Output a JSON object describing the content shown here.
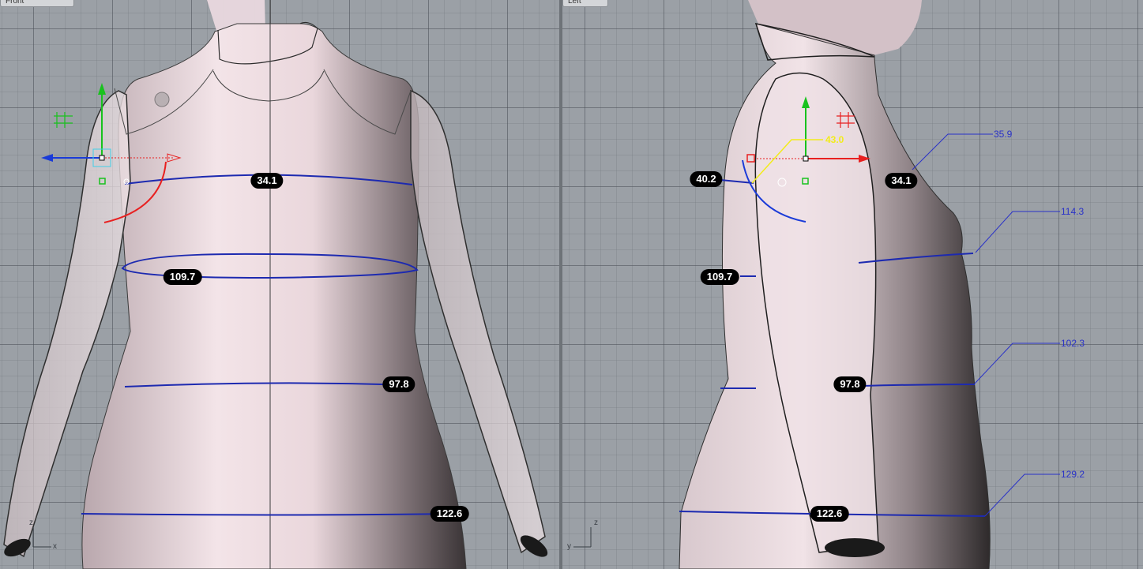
{
  "viewports": {
    "front": {
      "title": "Front"
    },
    "left": {
      "title": "Left"
    }
  },
  "front_measurements": {
    "shoulder": "34.1",
    "bust": "109.7",
    "waist": "97.8",
    "hip": "122.6"
  },
  "left_measurements": {
    "arm": "40.2",
    "shoulder": "34.1",
    "bust": "109.7",
    "waist": "97.8",
    "hip": "122.6"
  },
  "left_annotations": {
    "neck": "35.9",
    "bust": "114.3",
    "waist": "102.3",
    "hip": "129.2",
    "gumball_value": "43.0"
  },
  "axes": {
    "front": {
      "z": "z",
      "x": "x"
    },
    "left": {
      "z": "z",
      "y": "y"
    }
  },
  "colors": {
    "measure_line": "#1d2ab0",
    "label_bg": "#000000",
    "gumball_x": "#e82020",
    "gumball_y": "#18c21e",
    "gumball_z": "#1a3bd8",
    "annotation": "#2a32c8",
    "gumball_readout": "#f2ec1a"
  }
}
